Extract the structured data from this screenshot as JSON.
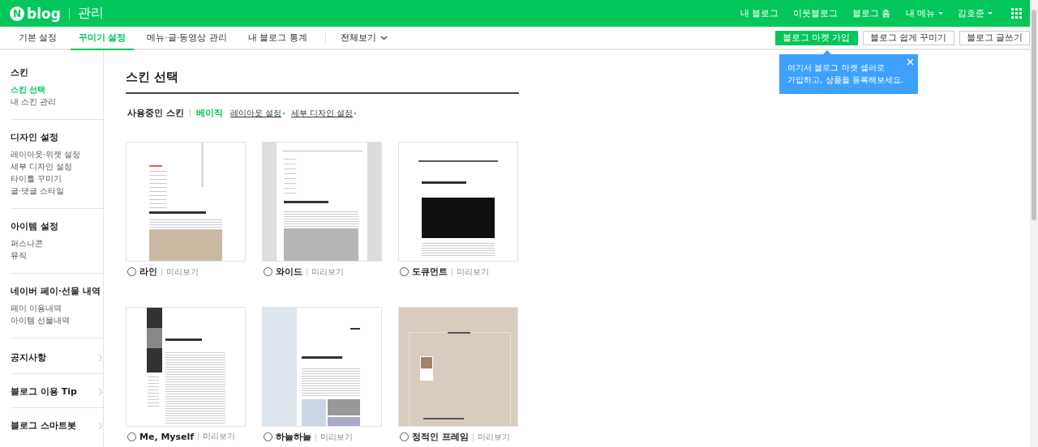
{
  "header": {
    "logo_mark": "N",
    "logo_text": "blog",
    "section": "관리",
    "nav": [
      {
        "label": "내 블로그",
        "dropdown": false
      },
      {
        "label": "이웃블로그",
        "dropdown": false
      },
      {
        "label": "블로그 홈",
        "dropdown": false
      },
      {
        "label": "내 메뉴",
        "dropdown": true
      },
      {
        "label": "김호준",
        "dropdown": true
      }
    ]
  },
  "tabs": [
    {
      "label": "기본 설정",
      "selected": false
    },
    {
      "label": "꾸미기 설정",
      "selected": true
    },
    {
      "label": "메뉴·글·동영상 관리",
      "selected": false
    },
    {
      "label": "내 블로그 통계",
      "selected": false
    }
  ],
  "view_all": "전체보기",
  "buttons": [
    {
      "label": "블로그 마켓 가입",
      "kind": "primary"
    },
    {
      "label": "블로그 쉽게 꾸미기",
      "kind": "default"
    },
    {
      "label": "블로그 글쓰기",
      "kind": "default"
    }
  ],
  "tooltip": {
    "text": "여기서 블로그 마켓 셀러로\n가입하고, 상품을 등록해보세요."
  },
  "sidebar": {
    "sections": [
      {
        "title": "스킨",
        "items": [
          {
            "label": "스킨 선택",
            "selected": true
          },
          {
            "label": "내 스킨 관리",
            "selected": false
          }
        ]
      },
      {
        "title": "디자인 설정",
        "items": [
          {
            "label": "레이아웃·위젯 설정",
            "selected": false
          },
          {
            "label": "세부 디자인 설정",
            "selected": false
          },
          {
            "label": "타이틀 꾸미기",
            "selected": false
          },
          {
            "label": "글·댓글 스타일",
            "selected": false
          }
        ]
      },
      {
        "title": "아이템 설정",
        "items": [
          {
            "label": "퍼스나콘",
            "selected": false
          },
          {
            "label": "뮤직",
            "selected": false
          }
        ]
      },
      {
        "title": "네이버 페이·선물 내역",
        "items": [
          {
            "label": "페이 이용내역",
            "selected": false
          },
          {
            "label": "아이템 선물내역",
            "selected": false
          }
        ]
      }
    ],
    "links": [
      {
        "label": "공지사항"
      },
      {
        "label": "블로그 이용 Tip"
      },
      {
        "label": "블로그 스마트봇"
      }
    ]
  },
  "page_title": "스킨 선택",
  "current_skin": {
    "label": "사용중인 스킨",
    "name": "베이직",
    "links": [
      "레이아웃 설정",
      "세부 디자인 설정"
    ]
  },
  "skins": [
    {
      "name": "라인",
      "preview": "미리보기",
      "selected": false,
      "kind": "line"
    },
    {
      "name": "와이드",
      "preview": "미리보기",
      "selected": false,
      "kind": "wide"
    },
    {
      "name": "도큐먼트",
      "preview": "미리보기",
      "selected": false,
      "kind": "document"
    },
    {
      "name": "Me, Myself",
      "preview": "미리보기",
      "selected": false,
      "kind": "dark"
    },
    {
      "name": "하늘하늘",
      "preview": "미리보기",
      "selected": false,
      "kind": "sky"
    },
    {
      "name": "정적인 프레임",
      "preview": "미리보기",
      "selected": false,
      "kind": "frame"
    }
  ]
}
